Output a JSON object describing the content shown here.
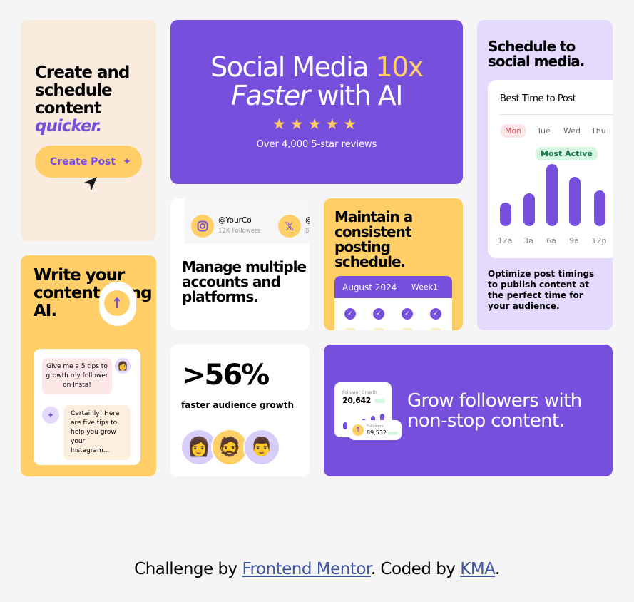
{
  "card_create": {
    "title": "Create and schedule content",
    "title_em": "quicker.",
    "button": "Create Post",
    "button_icon": "sparkle-icon",
    "cursor_icon": "cursor-icon"
  },
  "hero": {
    "line1_a": "Social Media ",
    "line1_b": "10x",
    "line2_a": "Faster",
    "line2_b": " with AI",
    "stars": "★★★★★",
    "reviews": "Over 4,000 5-star reviews"
  },
  "schedule": {
    "title": "Schedule to social media.",
    "panel_title": "Best Time to Post",
    "days": [
      "Mon",
      "Tue",
      "Wed",
      "Thu"
    ],
    "tag": "Most Active",
    "times": [
      "12a",
      "3a",
      "6a",
      "9a",
      "12p"
    ],
    "activity": [
      0.38,
      0.53,
      1.0,
      0.79,
      0.58
    ],
    "description": "Optimize post timings to publish content at the perfect time for your audience."
  },
  "write": {
    "title": "Write your content using AI.",
    "user_msg": "Give me a 5 tips to growth my follower on Insta!",
    "ai_msg": "Certainly! Here are five tips to help you grow your Instagram..."
  },
  "accounts": {
    "handle": "@YourCo",
    "followers": "12K Followers",
    "handle2": "@",
    "followers2": "8",
    "title": "Manage multiple accounts and platforms."
  },
  "consistent": {
    "title": "Maintain a consistent posting schedule.",
    "month": "August 2024",
    "week": "Week1"
  },
  "growth": {
    "stat": ">56%",
    "label": "faster audience growth"
  },
  "grow": {
    "widget_label": "Follower Growth",
    "widget_value": "20,642",
    "widget_bars": [
      0.45,
      0.6,
      0.7,
      0.85,
      1.0
    ],
    "followers_label": "Followers",
    "followers_value": "89,532",
    "title": "Grow followers with non-stop content."
  },
  "footer": {
    "prefix": "Challenge by ",
    "link1": "Frontend Mentor",
    "middle": ". Coded by ",
    "link2": "KMA",
    "suffix": "."
  },
  "colors": {
    "purple": "#7650dd",
    "yellow": "#ffce67",
    "lavender": "#e4dafe",
    "cream": "#f9ecdf"
  }
}
